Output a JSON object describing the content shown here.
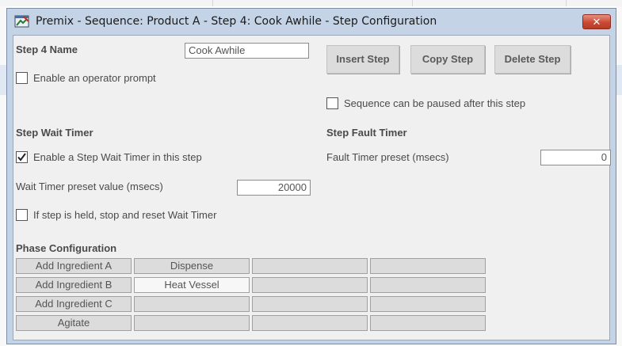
{
  "window": {
    "title": "Premix - Sequence: Product A - Step 4: Cook Awhile - Step Configuration",
    "close_glyph": "✕"
  },
  "step": {
    "name_label": "Step 4 Name",
    "name_value": "Cook Awhile",
    "operator_prompt_label": "Enable an operator prompt",
    "operator_prompt_checked": false,
    "pausable_label": "Sequence can be paused after this step",
    "pausable_checked": false
  },
  "buttons": {
    "insert": "Insert Step",
    "copy": "Copy Step",
    "delete": "Delete Step"
  },
  "wait_timer": {
    "header": "Step Wait Timer",
    "enable_label": "Enable a Step Wait Timer in this step",
    "enable_checked": true,
    "preset_label": "Wait Timer preset value (msecs)",
    "preset_value": "20000",
    "hold_reset_label": "If step is held, stop and reset Wait Timer",
    "hold_reset_checked": false
  },
  "fault_timer": {
    "header": "Step Fault Timer",
    "preset_label": "Fault Timer preset (msecs)",
    "preset_value": "0"
  },
  "phase": {
    "header": "Phase Configuration",
    "rows": [
      [
        "Add Ingredient A",
        "Dispense",
        "",
        ""
      ],
      [
        "Add Ingredient B",
        "Heat Vessel",
        "",
        ""
      ],
      [
        "Add Ingredient C",
        "",
        "",
        ""
      ],
      [
        "Agitate",
        "",
        "",
        ""
      ]
    ]
  },
  "colors": {
    "window_frame": "#c4d3e6",
    "close_button": "#c94a34",
    "client_background": "#f0f0f0"
  }
}
